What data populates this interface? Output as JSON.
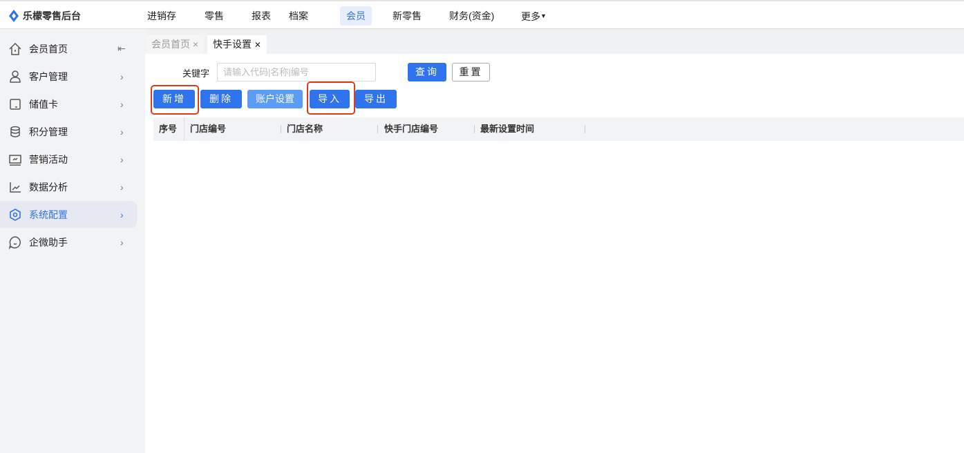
{
  "app": {
    "title": "乐檬零售后台"
  },
  "nav": [
    "进销存",
    "零售",
    "报表",
    "档案",
    "会员",
    "新零售",
    "财务(资金)",
    "更多"
  ],
  "nav_active": "会员",
  "sidebar": [
    {
      "label": "会员首页",
      "icon": "home-icon"
    },
    {
      "label": "客户管理",
      "icon": "user-icon"
    },
    {
      "label": "储值卡",
      "icon": "card-icon"
    },
    {
      "label": "积分管理",
      "icon": "database-icon"
    },
    {
      "label": "营销活动",
      "icon": "monitor-chart-icon"
    },
    {
      "label": "数据分析",
      "icon": "line-chart-icon"
    },
    {
      "label": "系统配置",
      "icon": "settings-hex-icon"
    },
    {
      "label": "企微助手",
      "icon": "chat-icon"
    }
  ],
  "tabs": [
    {
      "label": "会员首页",
      "close": "×"
    },
    {
      "label": "快手设置",
      "close": "✕"
    }
  ],
  "search": {
    "label": "关键字",
    "placeholder": "请输入代码|名称|编号",
    "value": "",
    "query": "查询",
    "reset": "重置"
  },
  "actions": {
    "add": "新增",
    "delete": "删除",
    "account": "账户设置",
    "import": "导入",
    "export": "导出"
  },
  "table": {
    "columns": [
      "序号",
      "门店编号",
      "门店名称",
      "快手门店编号",
      "最新设置时间"
    ],
    "rows": []
  },
  "colors": {
    "accent": "#2f74ec",
    "highlight": "#e03a1e"
  }
}
